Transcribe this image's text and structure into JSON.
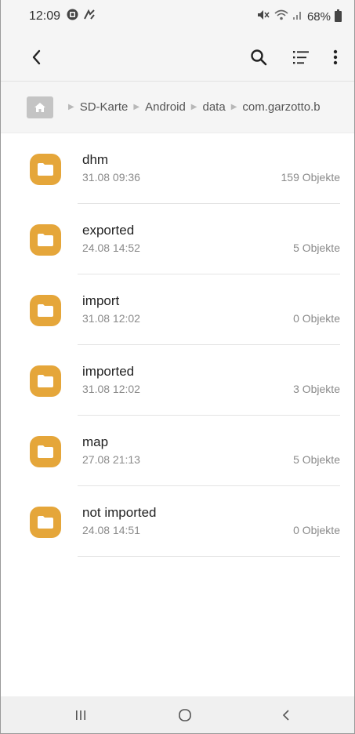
{
  "status_bar": {
    "time": "12:09",
    "battery": "68%"
  },
  "toolbar": {
    "icons": [
      "back-arrow-icon",
      "search-icon",
      "sort-list-icon",
      "more-vertical-icon"
    ]
  },
  "breadcrumb": {
    "items": [
      "SD-Karte",
      "Android",
      "data",
      "com.garzotto.b"
    ]
  },
  "folders": [
    {
      "name": "dhm",
      "date": "31.08 09:36",
      "count": "159 Objekte"
    },
    {
      "name": "exported",
      "date": "24.08 14:52",
      "count": "5 Objekte"
    },
    {
      "name": "import",
      "date": "31.08 12:02",
      "count": "0 Objekte"
    },
    {
      "name": "imported",
      "date": "31.08 12:02",
      "count": "3 Objekte"
    },
    {
      "name": "map",
      "date": "27.08 21:13",
      "count": "5 Objekte"
    },
    {
      "name": "not imported",
      "date": "24.08 14:51",
      "count": "0 Objekte"
    }
  ],
  "colors": {
    "folder": "#e5a63a",
    "bar_background": "#f5f5f5"
  }
}
